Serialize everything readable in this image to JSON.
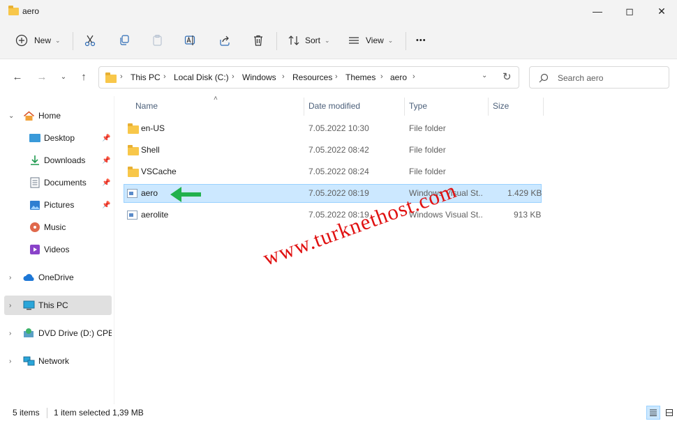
{
  "window": {
    "title": "aero"
  },
  "toolbar": {
    "new_label": "New",
    "sort_label": "Sort",
    "view_label": "View",
    "more_label": "•••"
  },
  "breadcrumb": [
    "This PC",
    "Local Disk (C:)",
    "Windows",
    "Resources",
    "Themes",
    "aero"
  ],
  "search": {
    "placeholder": "Search aero"
  },
  "sidebar": {
    "items": [
      {
        "label": "Home"
      },
      {
        "label": "Desktop"
      },
      {
        "label": "Downloads"
      },
      {
        "label": "Documents"
      },
      {
        "label": "Pictures"
      },
      {
        "label": "Music"
      },
      {
        "label": "Videos"
      },
      {
        "label": "OneDrive"
      },
      {
        "label": "This PC"
      },
      {
        "label": "DVD Drive (D:) CPBA"
      },
      {
        "label": "Network"
      }
    ]
  },
  "columns": {
    "name": "Name",
    "date": "Date modified",
    "type": "Type",
    "size": "Size"
  },
  "files": [
    {
      "name": "en-US",
      "date": "7.05.2022 10:30",
      "type": "File folder",
      "size": ""
    },
    {
      "name": "Shell",
      "date": "7.05.2022 08:42",
      "type": "File folder",
      "size": ""
    },
    {
      "name": "VSCache",
      "date": "7.05.2022 08:24",
      "type": "File folder",
      "size": ""
    },
    {
      "name": "aero",
      "date": "7.05.2022 08:19",
      "type": "Windows Visual St...",
      "size": "1.429 KB"
    },
    {
      "name": "aerolite",
      "date": "7.05.2022 08:19",
      "type": "Windows Visual St...",
      "size": "913 KB"
    }
  ],
  "status": {
    "items": "5 items",
    "selection": "1 item selected 1,39 MB"
  },
  "watermark": "www.turknethost.com",
  "colors": {
    "selection": "#cce8ff",
    "accent": "#0067c0",
    "arrow": "#22b14c",
    "watermark": "#e01111"
  }
}
